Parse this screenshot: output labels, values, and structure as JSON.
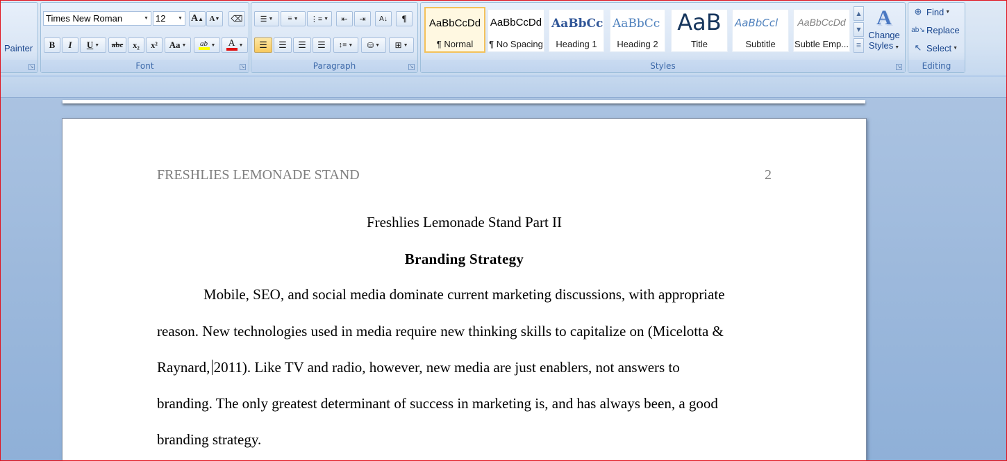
{
  "ribbon": {
    "clipboard": {
      "painter_label": "Painter"
    },
    "font": {
      "group_label": "Font",
      "font_name": "Times New Roman",
      "font_size": "12",
      "grow_label": "A",
      "shrink_label": "A",
      "bold_label": "B",
      "italic_label": "I",
      "underline_label": "U",
      "strike_label": "abc",
      "subscript_label": "x₂",
      "superscript_label": "x²",
      "case_label": "Aa",
      "highlight_label": "ab",
      "font_color_label": "A",
      "highlight_color": "#ffff00",
      "font_color": "#e01010"
    },
    "paragraph": {
      "group_label": "Paragraph",
      "show_marks_label": "¶"
    },
    "styles": {
      "group_label": "Styles",
      "items": [
        {
          "sample": "AaBbCcDd",
          "name": "¶ Normal"
        },
        {
          "sample": "AaBbCcDd",
          "name": "¶ No Spacing"
        },
        {
          "sample": "AaBbCc",
          "name": "Heading 1"
        },
        {
          "sample": "AaBbCc",
          "name": "Heading 2"
        },
        {
          "sample": "AaB",
          "name": "Title"
        },
        {
          "sample": "AaBbCcl",
          "name": "Subtitle"
        },
        {
          "sample": "AaBbCcDd",
          "name": "Subtle Emp..."
        }
      ],
      "change_styles_line1": "Change",
      "change_styles_line2": "Styles"
    },
    "editing": {
      "group_label": "Editing",
      "find_label": "Find",
      "replace_label": "Replace",
      "select_label": "Select"
    }
  },
  "document": {
    "header_text": "FRESHLIES LEMONADE STAND",
    "page_number": "2",
    "title": "Freshlies Lemonade Stand Part II",
    "heading": "Branding Strategy",
    "paragraph_lines": [
      "Mobile, SEO, and social media dominate current marketing discussions, with appropriate",
      "reason. New technologies used in media require new thinking skills to capitalize on (Micelotta &",
      "Raynard, 2011). Like TV and radio, however, new media are just enablers, not answers to",
      "branding. The only greatest determinant of success in marketing is, and has always been, a good",
      "branding strategy."
    ]
  }
}
